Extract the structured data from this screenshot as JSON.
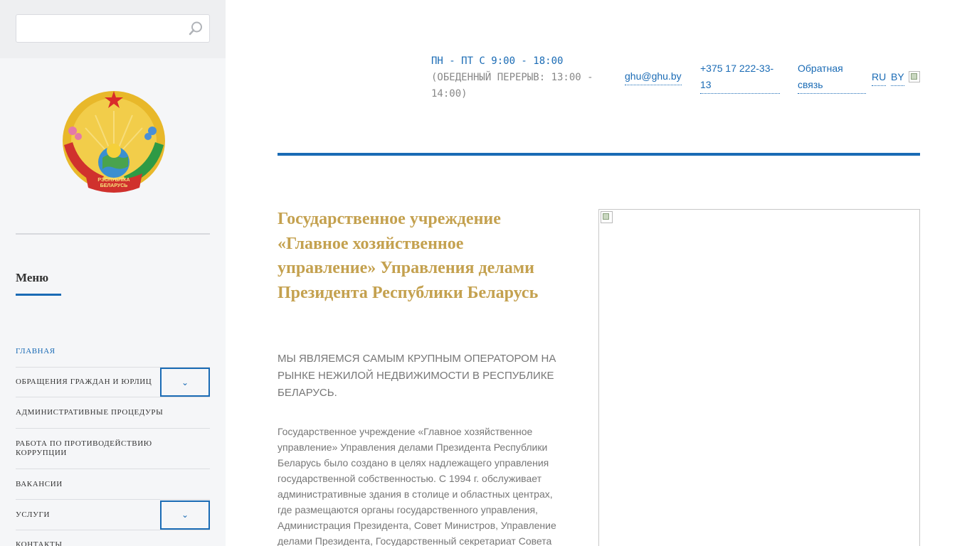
{
  "search": {
    "placeholder": "",
    "value": ""
  },
  "sidebar": {
    "menu_title": "Меню",
    "items": [
      {
        "label": "Главная",
        "active": true,
        "expandable": false
      },
      {
        "label": "Обращения граждан и юрлиц",
        "active": false,
        "expandable": true
      },
      {
        "label": "Административные процедуры",
        "active": false,
        "expandable": false
      },
      {
        "label": "Работа по противодействию коррупции",
        "active": false,
        "expandable": false
      },
      {
        "label": "Вакансии",
        "active": false,
        "expandable": false
      },
      {
        "label": "Услуги",
        "active": false,
        "expandable": true
      },
      {
        "label": "Контакты",
        "active": false,
        "expandable": false
      }
    ]
  },
  "emblem": {
    "ribbon_text": "РЭСПУБЛІКА БЕЛАРУСЬ"
  },
  "header": {
    "hours_main": "ПН - ПТ С 9:00 - 18:00",
    "hours_sub": "(ОБЕДЕННЫЙ ПЕРЕРЫВ: 13:00 - 14:00)",
    "email": "ghu@ghu.by",
    "phone": "+375 17 222-33-13",
    "feedback": "Обратная связь",
    "lang_ru": "RU",
    "lang_by": "BY"
  },
  "main": {
    "title": "Государственное учреждение «Главное хозяйственное управление» Управления делами Президента Республики Беларусь",
    "lead": "Мы являемся самым крупным оператором на рынке нежилой недвижимости в Республике Беларусь.",
    "body": "Государственное учреждение «Главное хозяйственное управление» Управления делами Президента Республики Беларусь было создано в целях надлежащего управления государственной собственностью. С 1994 г. обслуживает административные здания в столице и областных центрах, где размещаются органы государственного управления, Администрация Президента, Совет Министров, Управление делами Президента, Государственный секретариат Совета"
  },
  "colors": {
    "accent_blue": "#1a6bb5",
    "title_gold": "#c4a14f",
    "sidebar_bg": "#f5f6f8"
  }
}
